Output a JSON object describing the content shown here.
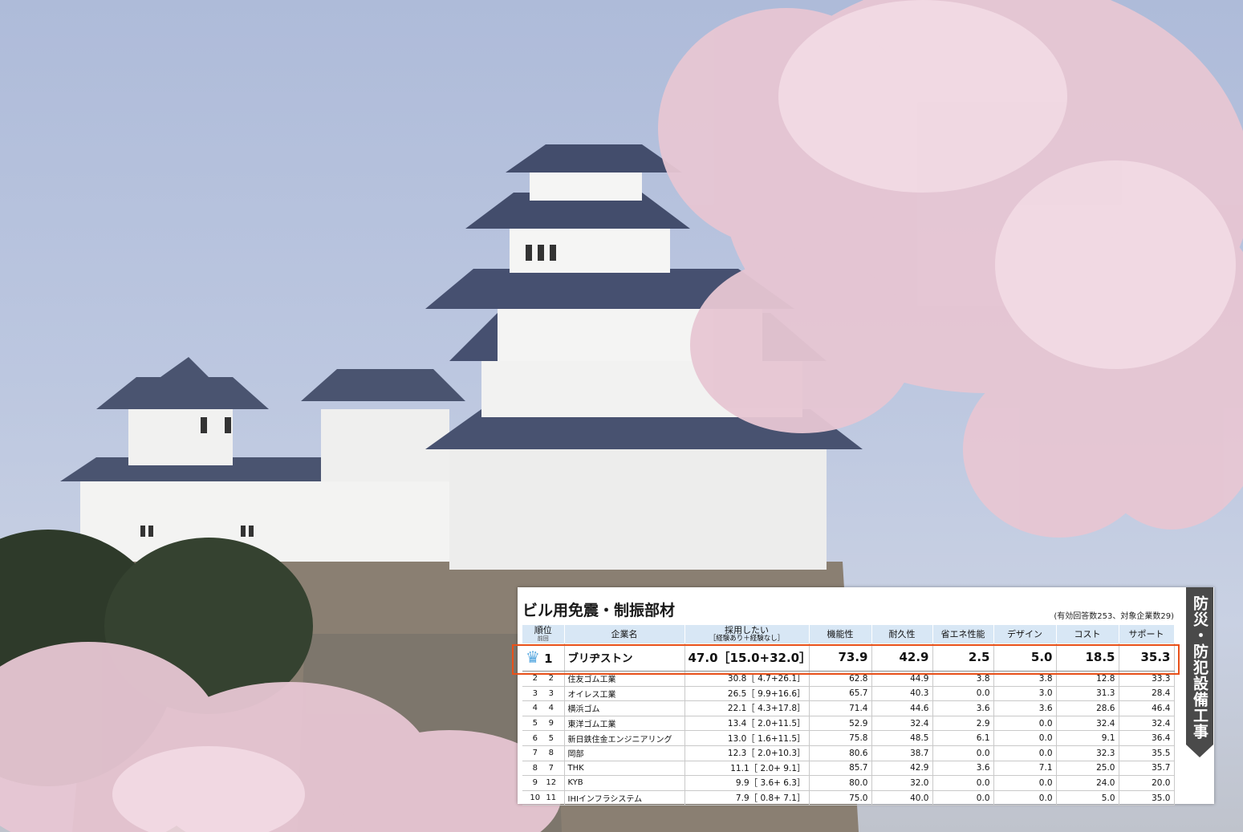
{
  "card": {
    "title": "ビル用免震・制振部材",
    "note": "(有効回答数253、対象企業数29)",
    "side_tab": "防災・防犯設備工事"
  },
  "columns": {
    "rank": "順位",
    "prev_rank": "前回",
    "company": "企業名",
    "adopt": "採用したい",
    "adopt_sub": "［経験あり＋経験なし］",
    "function": "機能性",
    "durability": "耐久性",
    "energy": "省エネ性能",
    "design": "デザイン",
    "cost": "コスト",
    "support": "サポート"
  },
  "rows": [
    {
      "rank": "1",
      "prev": "1",
      "company": "ブリヂストン",
      "adopt": "47.0［15.0+32.0］",
      "function": "73.9",
      "durability": "42.9",
      "energy": "2.5",
      "design": "5.0",
      "cost": "18.5",
      "support": "35.3"
    },
    {
      "rank": "2",
      "prev": "2",
      "company": "住友ゴム工業",
      "adopt": "30.8［ 4.7+26.1］",
      "function": "62.8",
      "durability": "44.9",
      "energy": "3.8",
      "design": "3.8",
      "cost": "12.8",
      "support": "33.3"
    },
    {
      "rank": "3",
      "prev": "3",
      "company": "オイレス工業",
      "adopt": "26.5［ 9.9+16.6］",
      "function": "65.7",
      "durability": "40.3",
      "energy": "0.0",
      "design": "3.0",
      "cost": "31.3",
      "support": "28.4"
    },
    {
      "rank": "4",
      "prev": "4",
      "company": "横浜ゴム",
      "adopt": "22.1［ 4.3+17.8］",
      "function": "71.4",
      "durability": "44.6",
      "energy": "3.6",
      "design": "3.6",
      "cost": "28.6",
      "support": "46.4"
    },
    {
      "rank": "5",
      "prev": "9",
      "company": "東洋ゴム工業",
      "adopt": "13.4［ 2.0+11.5］",
      "function": "52.9",
      "durability": "32.4",
      "energy": "2.9",
      "design": "0.0",
      "cost": "32.4",
      "support": "32.4"
    },
    {
      "rank": "6",
      "prev": "5",
      "company": "新日鉄住金エンジニアリング",
      "adopt": "13.0［ 1.6+11.5］",
      "function": "75.8",
      "durability": "48.5",
      "energy": "6.1",
      "design": "0.0",
      "cost": "9.1",
      "support": "36.4"
    },
    {
      "rank": "7",
      "prev": "8",
      "company": "岡部",
      "adopt": "12.3［ 2.0+10.3］",
      "function": "80.6",
      "durability": "38.7",
      "energy": "0.0",
      "design": "0.0",
      "cost": "32.3",
      "support": "35.5"
    },
    {
      "rank": "8",
      "prev": "7",
      "company": "THK",
      "adopt": "11.1［ 2.0+ 9.1］",
      "function": "85.7",
      "durability": "42.9",
      "energy": "3.6",
      "design": "7.1",
      "cost": "25.0",
      "support": "35.7"
    },
    {
      "rank": "9",
      "prev": "12",
      "company": "KYB",
      "adopt": "9.9［ 3.6+ 6.3］",
      "function": "80.0",
      "durability": "32.0",
      "energy": "0.0",
      "design": "0.0",
      "cost": "24.0",
      "support": "20.0"
    },
    {
      "rank": "10",
      "prev": "11",
      "company": "IHIインフラシステム",
      "adopt": "7.9［ 0.8+ 7.1］",
      "function": "75.0",
      "durability": "40.0",
      "energy": "0.0",
      "design": "0.0",
      "cost": "5.0",
      "support": "35.0"
    }
  ],
  "icons": {
    "top_rank": "crown-icon"
  },
  "colors": {
    "header_bg": "#d8e7f5",
    "highlight": "#e8511a",
    "crown": "#57a8e0",
    "side_tab": "#4a4a4a"
  }
}
